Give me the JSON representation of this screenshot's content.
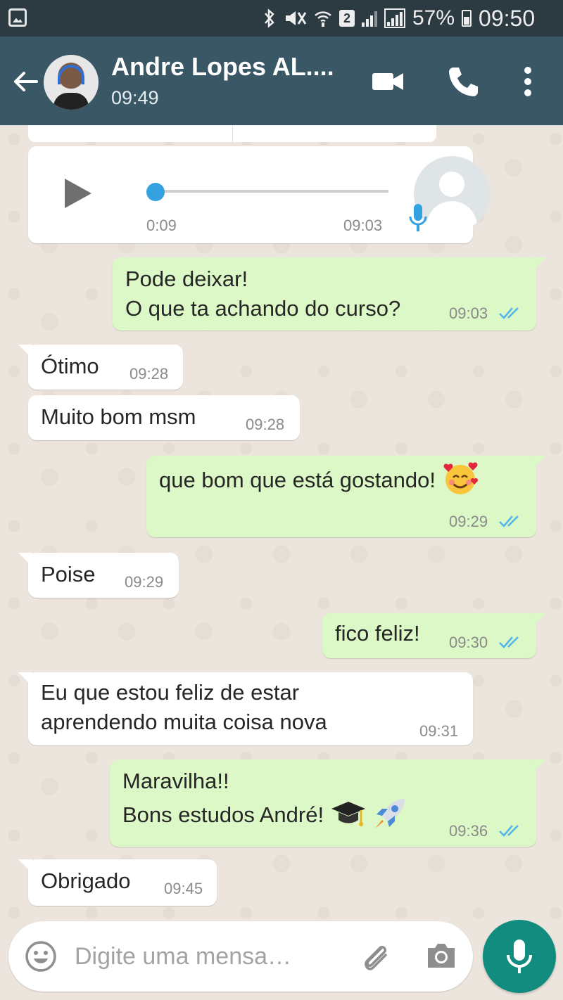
{
  "status_bar": {
    "battery_percent": "57%",
    "clock": "09:50",
    "sim_slot": "2"
  },
  "header": {
    "contact_name": "Andre Lopes AL....",
    "last_seen": "09:49"
  },
  "audio_message": {
    "duration": "0:09",
    "time": "09:03"
  },
  "messages": [
    {
      "direction": "out",
      "lines": [
        "Pode deixar!",
        "O que ta achando do curso?"
      ],
      "time": "09:03",
      "read": true
    },
    {
      "direction": "in",
      "lines": [
        "Ótimo"
      ],
      "time": "09:28"
    },
    {
      "direction": "in",
      "lines": [
        "Muito bom msm"
      ],
      "time": "09:28"
    },
    {
      "direction": "out",
      "lines": [
        "que bom que está gostando!"
      ],
      "emoji": "smiling-face-with-hearts",
      "time": "09:29",
      "read": true
    },
    {
      "direction": "in",
      "lines": [
        "Poise"
      ],
      "time": "09:29"
    },
    {
      "direction": "out",
      "lines": [
        "fico feliz!"
      ],
      "time": "09:30",
      "read": true
    },
    {
      "direction": "in",
      "lines": [
        "Eu que estou feliz de estar",
        "aprendendo muita coisa nova"
      ],
      "time": "09:31"
    },
    {
      "direction": "out",
      "lines": [
        "Maravilha!!",
        "Bons estudos André!"
      ],
      "emoji": "graduation-cap rocket",
      "time": "09:36",
      "read": true
    },
    {
      "direction": "in",
      "lines": [
        "Obrigado"
      ],
      "time": "09:45"
    }
  ],
  "composer": {
    "placeholder": "Digite uma mensa…"
  },
  "colors": {
    "header": "#3a5766",
    "status_bar": "#2c3a42",
    "outgoing_bubble": "#dcf8c6",
    "incoming_bubble": "#ffffff",
    "read_ticks": "#4fb6ec",
    "fab": "#128c7e",
    "audio_accent": "#34a2e0"
  },
  "icons": {
    "status": [
      "gallery-icon",
      "bluetooth-icon",
      "mute-icon",
      "wifi-icon",
      "sim-icon",
      "signal-icon",
      "battery-icon"
    ],
    "header": [
      "back-arrow-icon",
      "video-call-icon",
      "phone-icon",
      "more-vert-icon"
    ],
    "composer": [
      "emoji-icon",
      "attach-icon",
      "camera-icon",
      "mic-icon"
    ]
  }
}
